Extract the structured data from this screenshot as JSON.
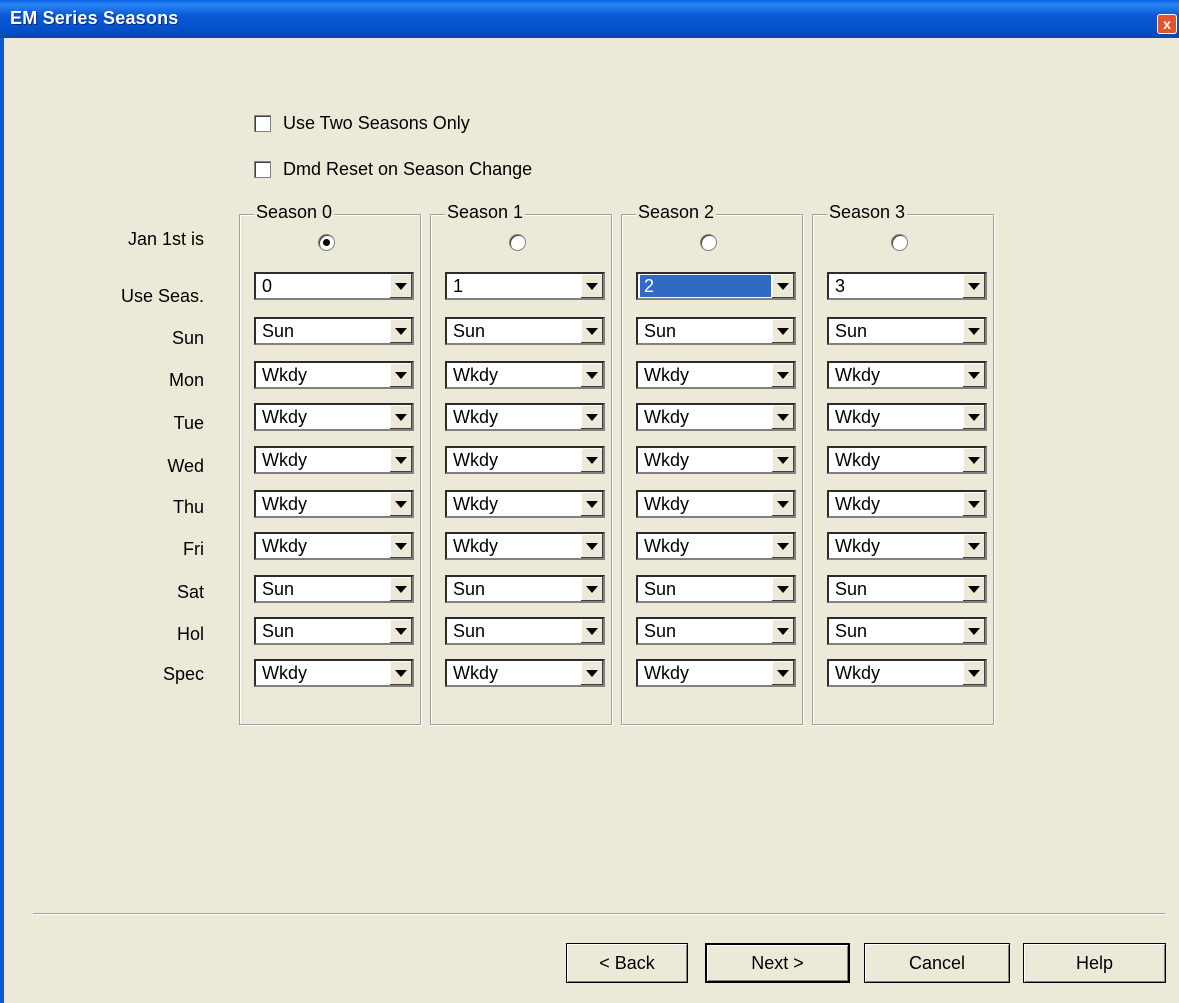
{
  "window": {
    "title": "EM Series Seasons",
    "close_symbol": "x"
  },
  "options": {
    "use_two_seasons": {
      "label": "Use Two Seasons Only",
      "checked": false
    },
    "dmd_reset": {
      "label": "Dmd Reset on Season Change",
      "checked": false
    }
  },
  "row_labels": [
    "Jan 1st is",
    "Use Seas.",
    "Sun",
    "Mon",
    "Tue",
    "Wed",
    "Thu",
    "Fri",
    "Sat",
    "Hol",
    "Spec"
  ],
  "seasons": [
    {
      "title": "Season 0",
      "jan1_selected": true,
      "use_seas": "0",
      "days": [
        "Sun",
        "Wkdy",
        "Wkdy",
        "Wkdy",
        "Wkdy",
        "Wkdy",
        "Sun",
        "Sun",
        "Wkdy"
      ]
    },
    {
      "title": "Season 1",
      "jan1_selected": false,
      "use_seas": "1",
      "days": [
        "Sun",
        "Wkdy",
        "Wkdy",
        "Wkdy",
        "Wkdy",
        "Wkdy",
        "Sun",
        "Sun",
        "Wkdy"
      ]
    },
    {
      "title": "Season 2",
      "jan1_selected": false,
      "use_seas": "2",
      "use_seas_highlighted": true,
      "days": [
        "Sun",
        "Wkdy",
        "Wkdy",
        "Wkdy",
        "Wkdy",
        "Wkdy",
        "Sun",
        "Sun",
        "Wkdy"
      ]
    },
    {
      "title": "Season 3",
      "jan1_selected": false,
      "use_seas": "3",
      "days": [
        "Sun",
        "Wkdy",
        "Wkdy",
        "Wkdy",
        "Wkdy",
        "Wkdy",
        "Sun",
        "Sun",
        "Wkdy"
      ]
    }
  ],
  "buttons": {
    "back": "< Back",
    "next": "Next >",
    "cancel": "Cancel",
    "help": "Help"
  }
}
